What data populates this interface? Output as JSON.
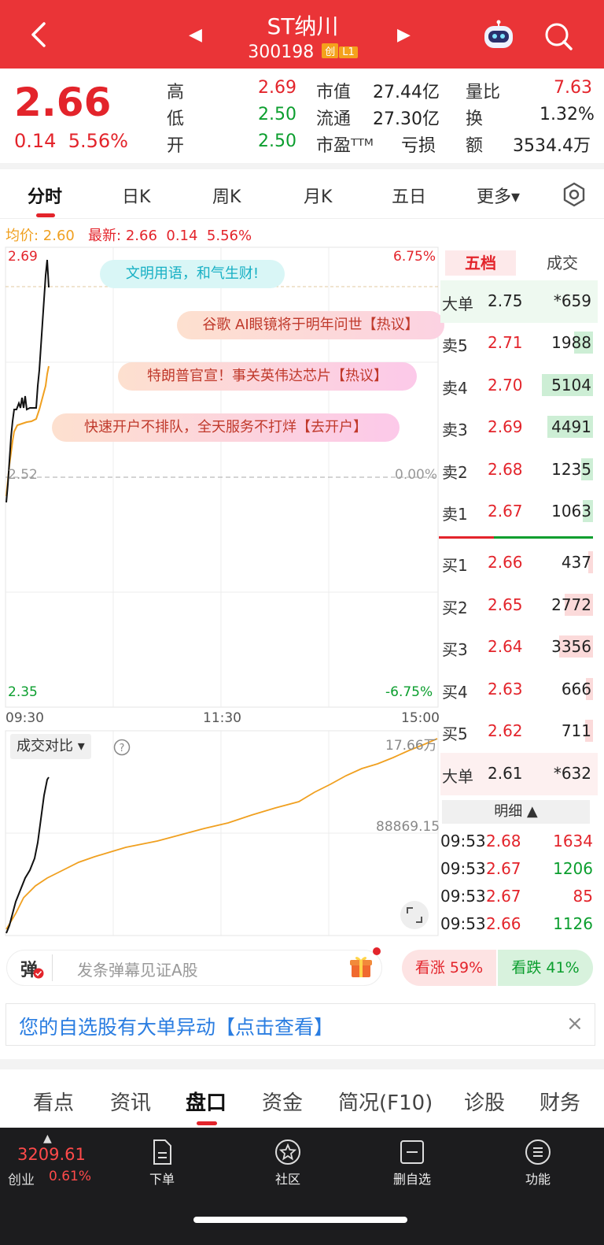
{
  "header": {
    "title": "ST纳川",
    "code": "300198",
    "tags": [
      "创",
      "L1"
    ]
  },
  "quote": {
    "price": "2.66",
    "change": "0.14",
    "change_pct": "5.56%",
    "high_label": "高",
    "high": "2.69",
    "low_label": "低",
    "low": "2.50",
    "open_label": "开",
    "open": "2.50",
    "mcap_label": "市值",
    "mcap": "27.44亿",
    "float_label": "流通",
    "float": "27.30亿",
    "pe_label": "市盈ᵀᵀᴹ",
    "pe": "亏损",
    "volratio_label": "量比",
    "volratio": "7.63",
    "turnover_label": "换",
    "turnover": "1.32%",
    "amount_label": "额",
    "amount": "3534.4万"
  },
  "chart_tabs": [
    "分时",
    "日K",
    "周K",
    "月K",
    "五日",
    "更多▾"
  ],
  "avg_row": {
    "avg": "均价: 2.60",
    "latest": "最新: 2.66",
    "change": "0.14",
    "pct": "5.56%"
  },
  "chart": {
    "ymax": "2.69",
    "ymax_pct": "6.75%",
    "mid": "2.52",
    "mid_pct": "0.00%",
    "ymin": "2.35",
    "ymin_pct": "-6.75%",
    "x_labels": [
      "09:30",
      "11:30",
      "15:00"
    ],
    "vol_compare_label": "成交对比 ▾",
    "vol_max": "17.66万",
    "vol_mid": "88869.15"
  },
  "bubbles": [
    "文明用语，和气生财!",
    "谷歌 AI眼镜将于明年问世【热议】",
    "特朗普官宣！事关英伟达芯片【热议】",
    "快速开户不排队，全天服务不打烊【去开户】"
  ],
  "orderbook": {
    "tab_five": "五档",
    "tab_deal": "成交",
    "big_sell": {
      "label": "大单",
      "price": "2.75",
      "vol": "*659"
    },
    "asks": [
      {
        "label": "卖5",
        "price": "2.71",
        "vol": "1988",
        "bar": 0.25
      },
      {
        "label": "卖4",
        "price": "2.70",
        "vol": "5104",
        "bar": 0.68
      },
      {
        "label": "卖3",
        "price": "2.69",
        "vol": "4491",
        "bar": 0.6
      },
      {
        "label": "卖2",
        "price": "2.68",
        "vol": "1235",
        "bar": 0.16
      },
      {
        "label": "卖1",
        "price": "2.67",
        "vol": "1063",
        "bar": 0.14
      }
    ],
    "bids": [
      {
        "label": "买1",
        "price": "2.66",
        "vol": "437",
        "bar": 0.06
      },
      {
        "label": "买2",
        "price": "2.65",
        "vol": "2772",
        "bar": 0.37
      },
      {
        "label": "买3",
        "price": "2.64",
        "vol": "3356",
        "bar": 0.45
      },
      {
        "label": "买4",
        "price": "2.63",
        "vol": "666",
        "bar": 0.09
      },
      {
        "label": "买5",
        "price": "2.62",
        "vol": "711",
        "bar": 0.1
      }
    ],
    "big_buy": {
      "label": "大单",
      "price": "2.61",
      "vol": "*632"
    },
    "detail_label": "明细 ▲",
    "trades": [
      {
        "time": "09:53",
        "price": "2.68",
        "vol": "1634",
        "side": "buy"
      },
      {
        "time": "09:53",
        "price": "2.67",
        "vol": "1206",
        "side": "sell"
      },
      {
        "time": "09:53",
        "price": "2.67",
        "vol": "85",
        "side": "buy"
      },
      {
        "time": "09:53",
        "price": "2.66",
        "vol": "1126",
        "side": "sell"
      }
    ]
  },
  "danmu": {
    "badge": "弹",
    "placeholder": "发条弹幕见证A股"
  },
  "sentiment": {
    "up": "看涨 59%",
    "down": "看跌 41%"
  },
  "notice": {
    "text": "您的自选股有大单异动【点击查看】",
    "close": "×"
  },
  "bottom_tabs": [
    "看点",
    "资讯",
    "盘口",
    "资金",
    "简况(F10)",
    "诊股",
    "财务"
  ],
  "tabbar": {
    "index_value": "3209.61",
    "index_name": "创业",
    "index_pct": "0.61%",
    "items": [
      "下单",
      "社区",
      "删自选",
      "功能"
    ]
  },
  "colors": {
    "brand_red": "#ea3437",
    "up": "#e3242b",
    "down": "#0b9e2e",
    "avg_line": "#f0a020"
  }
}
